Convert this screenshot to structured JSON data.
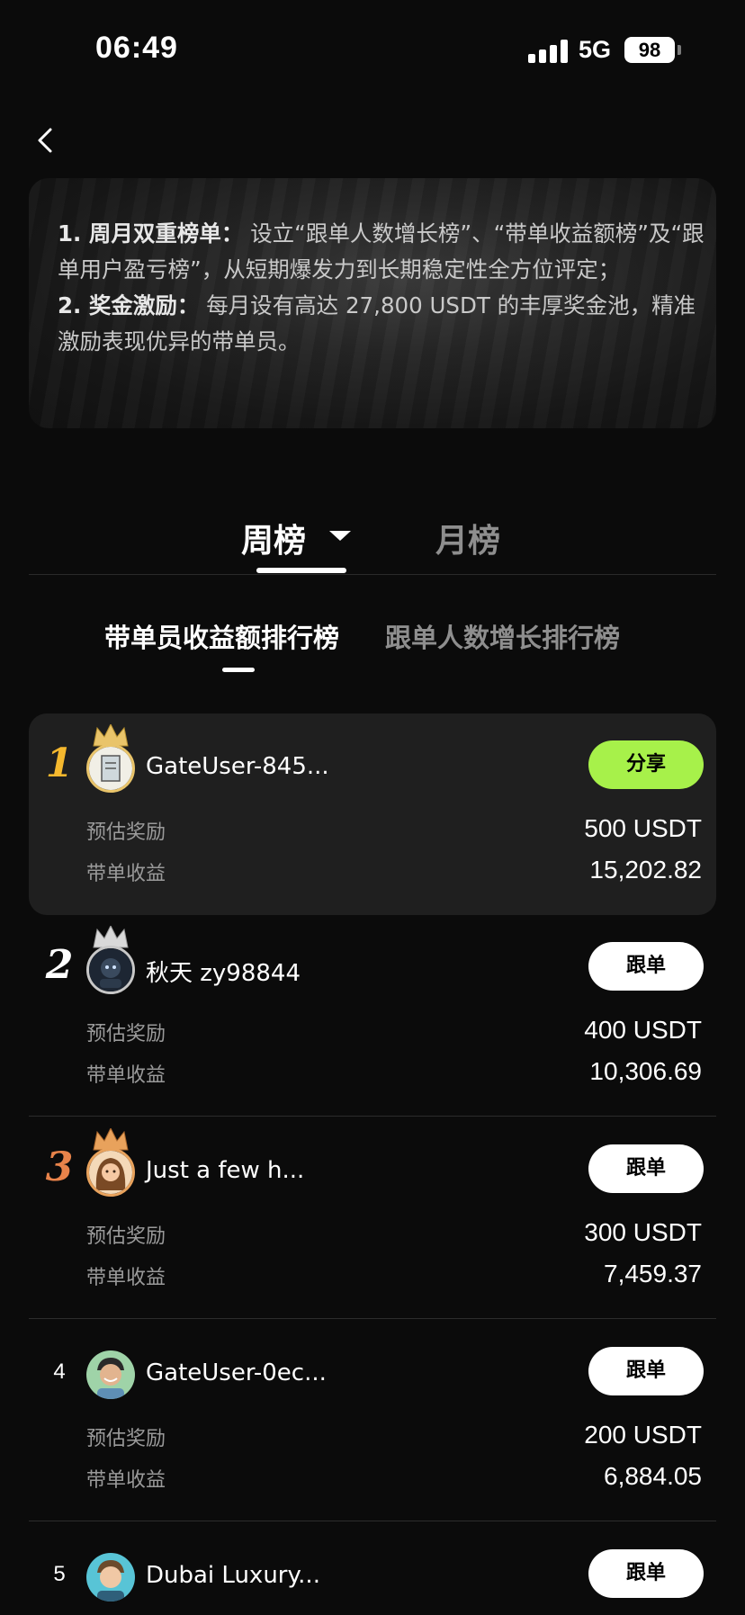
{
  "status_bar": {
    "time": "06:49",
    "network": "5G",
    "battery": "98"
  },
  "intro": {
    "item1_title": "1. 周月双重榜单：",
    "item1_text": "设立“跟单人数增长榜”、“带单收益额榜”及“跟单用户盈亏榜”，从短期爆发力到长期稳定性全方位评定；",
    "item2_title": "2. 奖金激励：",
    "item2_text": "每月设有高达 27,800 USDT 的丰厚奖金池，精准激励表现优异的带单员。"
  },
  "period_tabs": {
    "week": "周榜",
    "month": "月榜"
  },
  "rank_tabs": {
    "active": "带单员收益额排行榜",
    "inactive": "跟单人数增长排行榜"
  },
  "labels": {
    "reward": "预估奖励",
    "profit": "带单收益"
  },
  "rankings": [
    {
      "rank": "1",
      "name": "GateUser-845...",
      "button": "分享",
      "reward": "500 USDT",
      "profit": "15,202.82"
    },
    {
      "rank": "2",
      "name": "秋天 zy98844",
      "button": "跟单",
      "reward": "400 USDT",
      "profit": "10,306.69"
    },
    {
      "rank": "3",
      "name": "Just a few h...",
      "button": "跟单",
      "reward": "300 USDT",
      "profit": "7,459.37"
    },
    {
      "rank": "4",
      "name": "GateUser-0ec...",
      "button": "跟单",
      "reward": "200 USDT",
      "profit": "6,884.05"
    },
    {
      "rank": "5",
      "name": "Dubai Luxury...",
      "button": "跟单"
    }
  ],
  "colors": {
    "gold": "#f5b82e",
    "silver": "#ffffff",
    "bronze": "#e8834a",
    "share_button": "#a7f14a"
  },
  "icons": [
    "back-icon",
    "signal-icon",
    "caret-down-icon",
    "crown-icon"
  ]
}
